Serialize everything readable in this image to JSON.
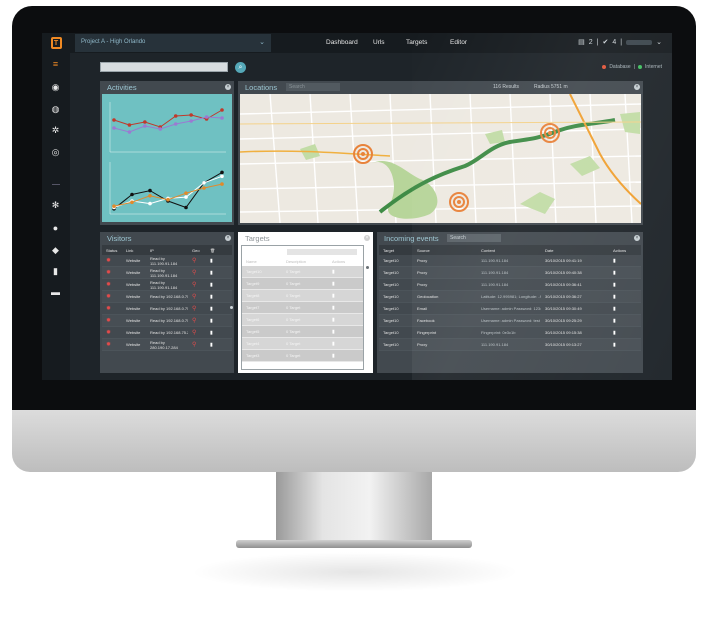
{
  "app": {
    "project": "Project A - High Orlando"
  },
  "nav": {
    "dashboard": "Dashboard",
    "urls": "Urls",
    "targets": "Targets",
    "editor": "Editor"
  },
  "status": {
    "docs_count": "2",
    "ok_count": "4",
    "separator": "|"
  },
  "legend": {
    "database": "Database",
    "internet": "Internet",
    "database_color": "#e0553a",
    "internet_color": "#3fbf5f"
  },
  "activities": {
    "title": "Activities"
  },
  "locations": {
    "title": "Locations",
    "search_placeholder": "Search",
    "results": "116 Results",
    "radius": "Radius 5751 m"
  },
  "visitors": {
    "title": "Visitors",
    "columns": [
      "Status",
      "Link",
      "IP",
      "Geo"
    ],
    "rows": [
      {
        "link": "Website",
        "ip": "Read by\n111.190.91.184"
      },
      {
        "link": "Website",
        "ip": "Read by\n111.190.91.184"
      },
      {
        "link": "Website",
        "ip": "Read by\n111.190.91.184"
      },
      {
        "link": "Website",
        "ip": "Read by 192.168.0.75"
      },
      {
        "link": "Website",
        "ip": "Read by 192.168.0.75"
      },
      {
        "link": "Website",
        "ip": "Read by 192.168.0.75"
      },
      {
        "link": "Website",
        "ip": "Read by 192.168.75.28"
      },
      {
        "link": "Website",
        "ip": "Read by\n280.190.17.284"
      }
    ]
  },
  "targets": {
    "title": "Targets",
    "columns": [
      "Name",
      "Description",
      "Actions"
    ],
    "rows": [
      {
        "name": "Target10",
        "desc": "0 Target"
      },
      {
        "name": "Target9",
        "desc": "0 Target"
      },
      {
        "name": "Target8",
        "desc": "0 Target"
      },
      {
        "name": "Target7",
        "desc": "0 Target"
      },
      {
        "name": "Target6",
        "desc": "0 Target"
      },
      {
        "name": "Target5",
        "desc": "0 Target"
      },
      {
        "name": "Target4",
        "desc": "0 Target"
      },
      {
        "name": "Target3",
        "desc": "0 Target"
      }
    ]
  },
  "events": {
    "title": "Incoming events",
    "search_placeholder": "Search",
    "columns": [
      "Target",
      "Source",
      "Content",
      "Date",
      "Actions"
    ],
    "rows": [
      {
        "target": "Target10",
        "source": "Proxy",
        "content": "111.190.91.184",
        "date": "30/10/2015 09:41:19"
      },
      {
        "target": "Target10",
        "source": "Proxy",
        "content": "111.190.91.184",
        "date": "30/10/2015 09:40:38"
      },
      {
        "target": "Target10",
        "source": "Proxy",
        "content": "111.190.91.184",
        "date": "30/10/2015 09:36:41"
      },
      {
        "target": "Target10",
        "source": "Geolocation",
        "content": "Latitude: 12.995981; Longitude: -96.7524",
        "date": "30/10/2015 09:36:27"
      },
      {
        "target": "Target10",
        "source": "Email",
        "content": "Username: admin Password: 123456",
        "date": "30/10/2015 09:30:49"
      },
      {
        "target": "Target10",
        "source": "Facebook",
        "content": "Username: admin Password: test",
        "date": "30/10/2015 09:25:29"
      },
      {
        "target": "Target10",
        "source": "Fingerprint",
        "content": "Fingerprint: 0e3c1b",
        "date": "30/10/2015 09:15:38"
      },
      {
        "target": "Target10",
        "source": "Proxy",
        "content": "111.190.91.184",
        "date": "30/10/2015 09:13:27"
      }
    ]
  },
  "chart_data": [
    {
      "type": "line",
      "series": [
        {
          "values": [
            3.2,
            2.7,
            3.0,
            2.5,
            3.6,
            3.7,
            3.3,
            4.2
          ],
          "color": "#c0392b"
        },
        {
          "values": [
            2.4,
            2.0,
            2.6,
            2.3,
            2.8,
            3.1,
            3.5,
            3.4
          ],
          "color": "#9b7ad2"
        }
      ],
      "ylim": [
        0,
        5
      ],
      "grid": false
    },
    {
      "type": "line",
      "series": [
        {
          "values": [
            0.4,
            1.5,
            1.8,
            1.0,
            0.5,
            2.4,
            3.2
          ],
          "color": "#111111"
        },
        {
          "values": [
            0.5,
            1.0,
            0.8,
            1.2,
            1.3,
            2.4,
            2.9
          ],
          "color": "#ffffff"
        },
        {
          "values": [
            0.6,
            0.9,
            1.4,
            1.1,
            1.6,
            2.0,
            2.3
          ],
          "color": "#e08a2c"
        }
      ],
      "ylim": [
        0,
        4
      ],
      "grid": false
    }
  ]
}
